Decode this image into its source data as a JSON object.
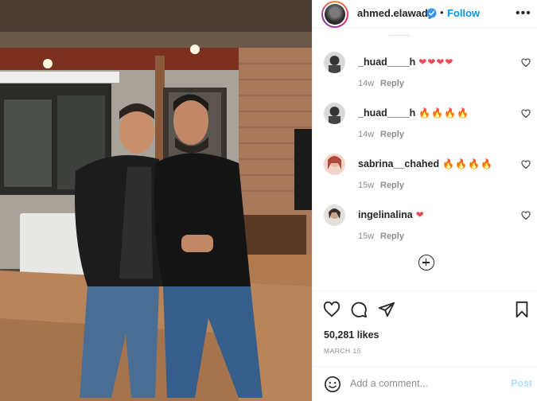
{
  "post": {
    "photo_alt": "Photo of two men standing together in a wood-paneled room",
    "author": {
      "username": "ahmed.elawady",
      "verified": true,
      "follow_label": "Follow",
      "separator": "•",
      "more_label": "•••"
    },
    "comments": [
      {
        "username": "_huad____h",
        "text": "❤❤❤❤",
        "age": "14w",
        "reply_label": "Reply"
      },
      {
        "username": "_huad____h",
        "text": "🔥🔥🔥🔥",
        "age": "14w",
        "reply_label": "Reply"
      },
      {
        "username": "sabrina__chahed",
        "text": "🔥🔥🔥🔥",
        "age": "15w",
        "reply_label": "Reply"
      },
      {
        "username": "ingelinalina",
        "text": "❤",
        "age": "15w",
        "reply_label": "Reply"
      }
    ],
    "actions": {
      "like_icon": "heart-icon",
      "comment_icon": "comment-icon",
      "share_icon": "share-icon",
      "save_icon": "bookmark-icon"
    },
    "likes_text": "50,281 likes",
    "date_text": "MARCH 15",
    "add_comment": {
      "placeholder": "Add a comment...",
      "post_label": "Post",
      "emoji_icon": "smiley-icon"
    },
    "colors": {
      "accent": "#0095f6",
      "post_disabled": "#b2dffc",
      "verified": "#3897f0",
      "heart_red": "#ed4956"
    }
  }
}
